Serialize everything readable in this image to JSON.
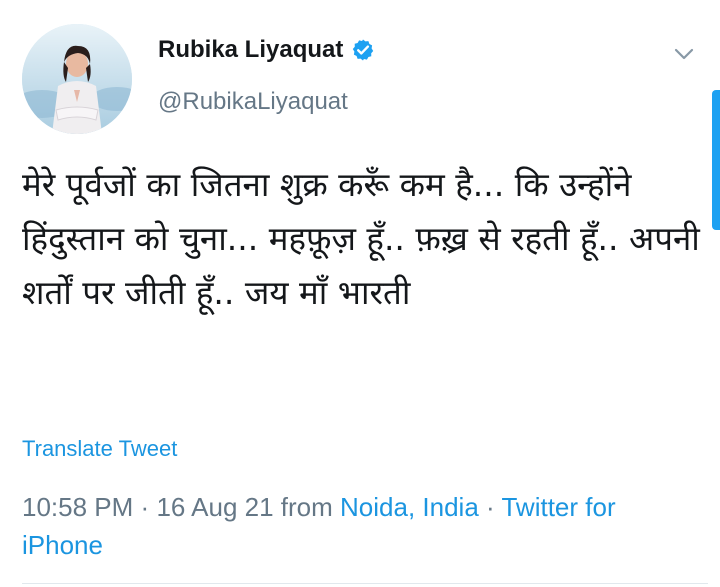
{
  "tweet": {
    "display_name": "Rubika Liyaquat",
    "handle": "@RubikaLiyaquat",
    "verified": true,
    "text": "मेरे पूर्वजों का जितना शुक्र करूँ कम है... कि उन्होंने हिंदुस्तान को चुना... महफ़ूज़ हूँ.. फ़ख़्र से रहती हूँ.. अपनी शर्तों पर जीती हूँ.. जय माँ भारती",
    "translate_label": "Translate Tweet",
    "time": "10:58 PM",
    "separator": "·",
    "date": "16 Aug 21",
    "from_label": "from",
    "location": "Noida, India",
    "source": "Twitter for iPhone"
  },
  "colors": {
    "link": "#1b95e0",
    "muted": "#657786",
    "verified": "#1da1f2"
  },
  "icons": {
    "verified": "verified-badge-icon",
    "menu": "chevron-down-icon"
  }
}
